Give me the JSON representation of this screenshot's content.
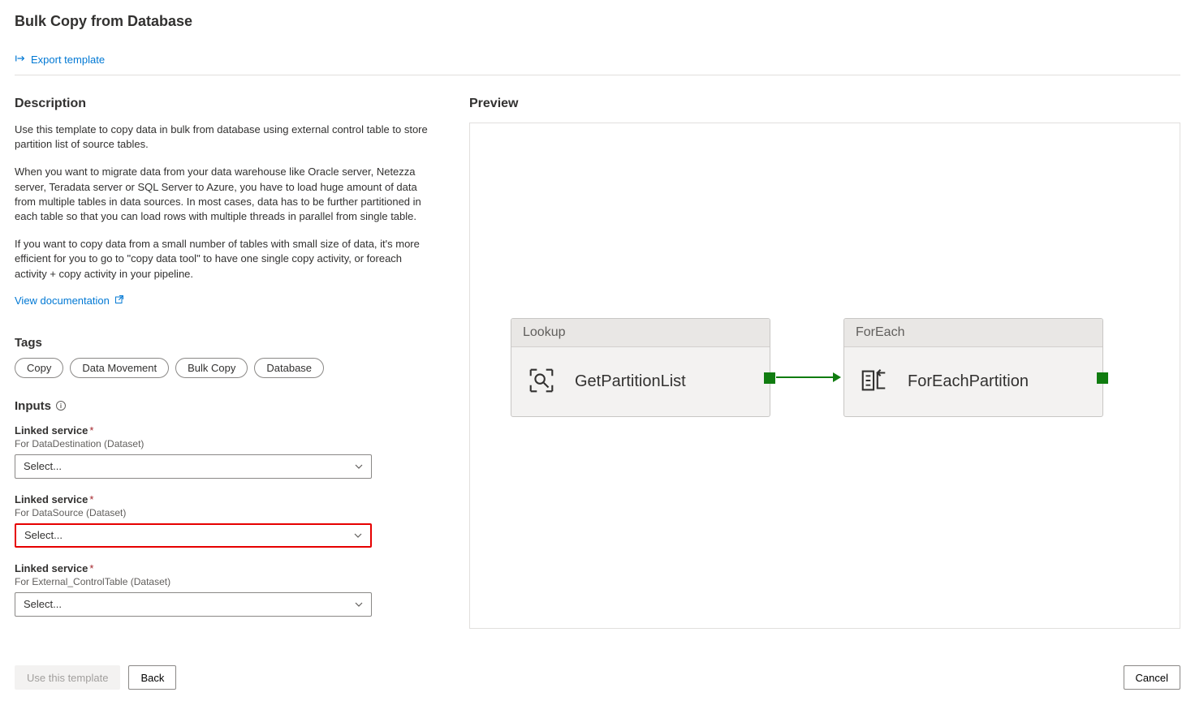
{
  "page_title": "Bulk Copy from Database",
  "export_template_label": "Export template",
  "description_heading": "Description",
  "description_p1": "Use this template to copy data in bulk from database using external control table to store partition list of source tables.",
  "description_p2": "When you want to migrate data from your data warehouse like Oracle server, Netezza server, Teradata server or SQL Server to Azure, you have to load huge amount of data from multiple tables in data sources. In most cases, data has to be further partitioned in each table so that you can load rows with multiple threads in parallel from single table.",
  "description_p3": "If you want to copy data from a small number of tables with small size of data, it's more efficient for you to go to \"copy data tool\" to have one single copy activity, or foreach activity + copy activity in your pipeline.",
  "view_documentation_label": "View documentation",
  "tags_heading": "Tags",
  "tags": [
    "Copy",
    "Data Movement",
    "Bulk Copy",
    "Database"
  ],
  "inputs_heading": "Inputs",
  "fields": [
    {
      "label": "Linked service",
      "sub": "For DataDestination (Dataset)",
      "value": "Select...",
      "highlight": false
    },
    {
      "label": "Linked service",
      "sub": "For DataSource (Dataset)",
      "value": "Select...",
      "highlight": true
    },
    {
      "label": "Linked service",
      "sub": "For External_ControlTable (Dataset)",
      "value": "Select...",
      "highlight": false
    }
  ],
  "preview_heading": "Preview",
  "nodes": {
    "lookup": {
      "header": "Lookup",
      "name": "GetPartitionList"
    },
    "foreach": {
      "header": "ForEach",
      "name": "ForEachPartition"
    }
  },
  "footer": {
    "use_template": "Use this template",
    "back": "Back",
    "cancel": "Cancel"
  }
}
